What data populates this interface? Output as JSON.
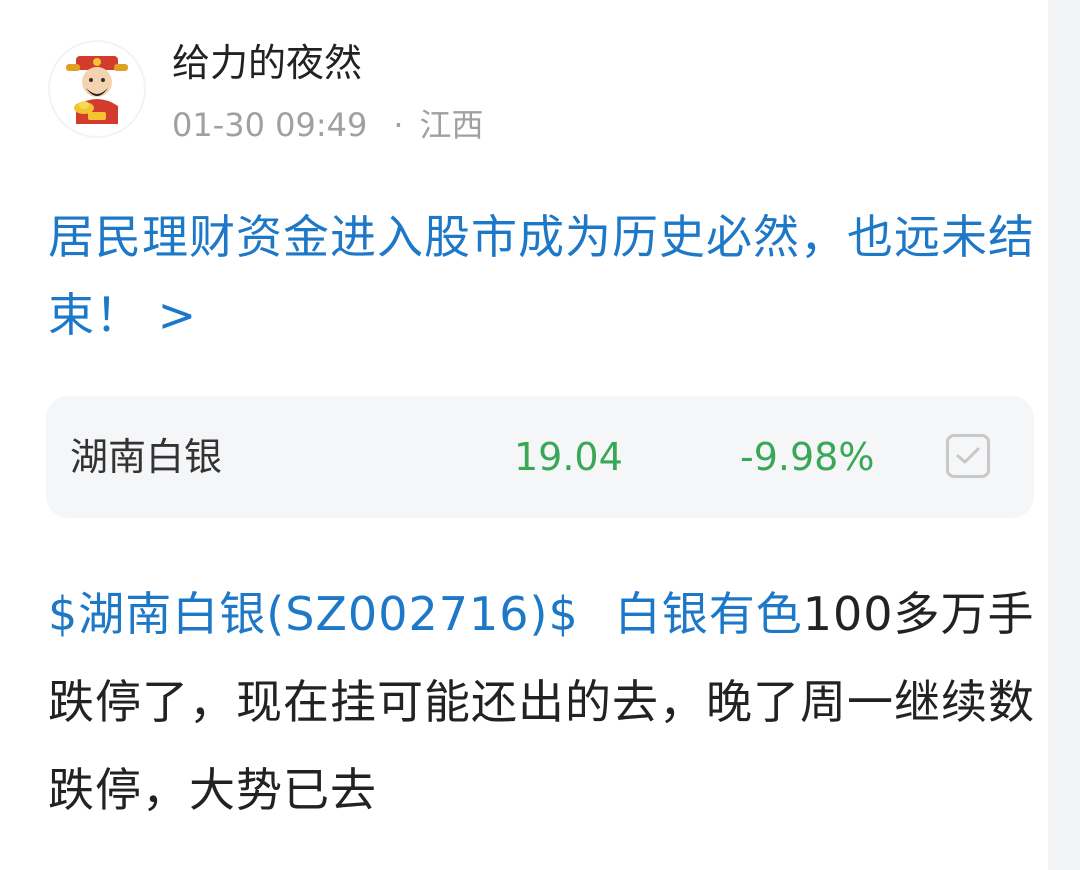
{
  "author": {
    "avatar_icon": "god-of-wealth-avatar-icon",
    "name": "给力的夜然",
    "time": "01-30 09:49",
    "separator": "·",
    "location": "江西"
  },
  "headline": {
    "text": "居民理财资金进入股市成为历史必然，也远未结束！ >"
  },
  "stock": {
    "name": "湖南白银",
    "price": "19.04",
    "change": "-9.98%",
    "color": "#3aa756",
    "checkbox_icon": "checkbox-check-icon"
  },
  "post": {
    "stock_tag": "$湖南白银(SZ002716)$",
    "topic_tag": "白银有色",
    "text": "100多万手跌停了，现在挂可能还出的去，晚了周一继续数跌停，大势已去"
  },
  "colors": {
    "link": "#1e78c8",
    "text": "#222222",
    "meta": "#a0a0a0",
    "card_bg": "#f5f6f8"
  }
}
